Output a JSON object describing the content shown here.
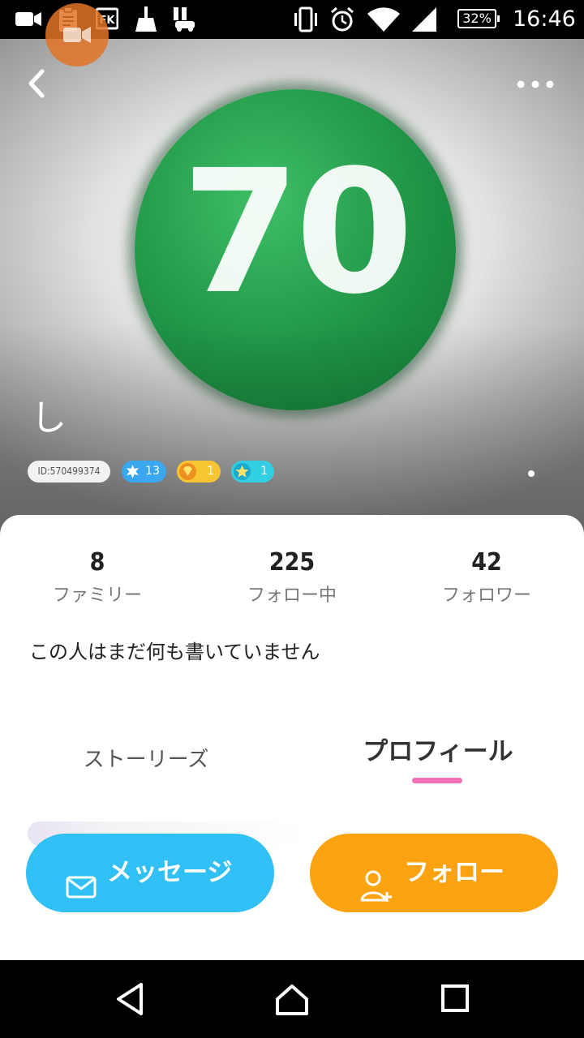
{
  "status_bar": {
    "battery": "32%",
    "time": "16:46",
    "left_icons": [
      "video-camera-icon",
      "clipboard-icon",
      "fk-app-icon",
      "broom-icon",
      "car-list-icon"
    ],
    "right_icons": [
      "vibrate-icon",
      "alarm-icon",
      "wifi-icon",
      "signal-icon"
    ]
  },
  "overlay": {
    "icon": "video-camera-icon",
    "color": "#e27426"
  },
  "hero": {
    "avatar_text": "70",
    "user_name": "し",
    "user_id": "ID:570499374",
    "badges": [
      {
        "icon": "star-burst-icon",
        "value": "13",
        "color": "#3aa7ee"
      },
      {
        "icon": "diamond-icon",
        "value": "1",
        "color": "#f7c531"
      },
      {
        "icon": "star-icon",
        "value": "1",
        "color": "#32cfe2"
      }
    ]
  },
  "stats": [
    {
      "value": "8",
      "label": "ファミリー"
    },
    {
      "value": "225",
      "label": "フォロー中"
    },
    {
      "value": "42",
      "label": "フォロワー"
    }
  ],
  "bio": "この人はまだ何も書いていません",
  "tabs": [
    {
      "label": "ストーリーズ",
      "active": false
    },
    {
      "label": "プロフィール",
      "active": true
    }
  ],
  "actions": {
    "message_label": "メッセージ",
    "follow_label": "フォロー"
  },
  "colors": {
    "message_button": "#30c0f6",
    "follow_button": "#fda311",
    "tab_indicator": "#f272b5",
    "avatar_green": "#1f9446"
  },
  "nav_bar": [
    "back-triangle-icon",
    "home-icon",
    "recents-icon"
  ]
}
